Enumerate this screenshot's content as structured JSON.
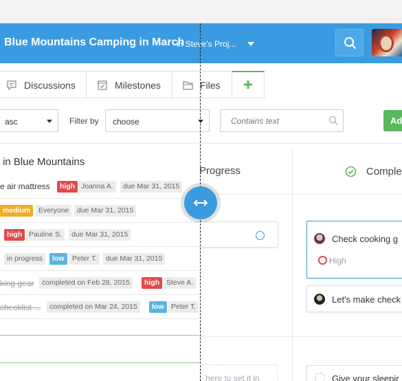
{
  "header": {
    "project_title": "Blue Mountains Camping in March",
    "project_sub": "in Steve's Proj...",
    "search_icon": "search-icon"
  },
  "tabs": [
    {
      "label": "Discussions",
      "icon": "discussions-icon"
    },
    {
      "label": "Milestones",
      "icon": "milestones-icon"
    },
    {
      "label": "Files",
      "icon": "files-icon"
    },
    {
      "label": "",
      "icon": "plus-icon"
    }
  ],
  "filters": {
    "sort_value": "asc",
    "filter_label": "Filter by",
    "filter_value": "choose",
    "text_placeholder": "Contains text",
    "add_label": "Ad"
  },
  "left": {
    "title": "in Blue Mountains",
    "rows": [
      {
        "title": "e air mattress",
        "chips": [
          {
            "kind": "high",
            "text": "high"
          },
          {
            "kind": "gray",
            "text": "Joanna A."
          },
          {
            "kind": "gray",
            "text": "due Mar 31, 2015"
          }
        ]
      },
      {
        "title": "",
        "chips": [
          {
            "kind": "medium",
            "text": "medium"
          },
          {
            "kind": "gray",
            "text": "Everyone"
          },
          {
            "kind": "gray",
            "text": "due Mar 31, 2015"
          }
        ]
      },
      {
        "title": "",
        "chips": [
          {
            "kind": "high",
            "text": "high"
          },
          {
            "kind": "gray",
            "text": "Pauline S."
          },
          {
            "kind": "gray",
            "text": "due Mar 31, 2015"
          }
        ]
      },
      {
        "title": "",
        "chips": [
          {
            "kind": "gray",
            "text": "in progress"
          },
          {
            "kind": "low",
            "text": "low"
          },
          {
            "kind": "gray",
            "text": "Peter T."
          },
          {
            "kind": "gray",
            "text": "due Mar 31, 2015"
          }
        ]
      },
      {
        "title": "king gear",
        "chips": [
          {
            "kind": "gray",
            "text": "completed on Feb 28, 2015"
          },
          {
            "kind": "high",
            "text": "high"
          },
          {
            "kind": "gray",
            "text": "Steve A."
          }
        ]
      },
      {
        "title": "checklist ...",
        "chips": [
          {
            "kind": "gray",
            "text": "completed on Mar 24, 2015"
          },
          {
            "kind": "low",
            "text": "low"
          },
          {
            "kind": "gray",
            "text": "Peter T."
          }
        ]
      }
    ]
  },
  "columns": {
    "in_progress": "Progress",
    "completed": "Comple",
    "drop_hint": "here to set it in"
  },
  "cards": {
    "check_cooking": "Check cooking g",
    "priority": "High",
    "lets_make": "Let's make check",
    "give_sleeping": "Give your sleepir"
  },
  "colors": {
    "accent": "#3a9be0",
    "high": "#e44a4a",
    "medium": "#f0ad23",
    "low": "#5bb4e0",
    "success": "#5bb75b"
  }
}
